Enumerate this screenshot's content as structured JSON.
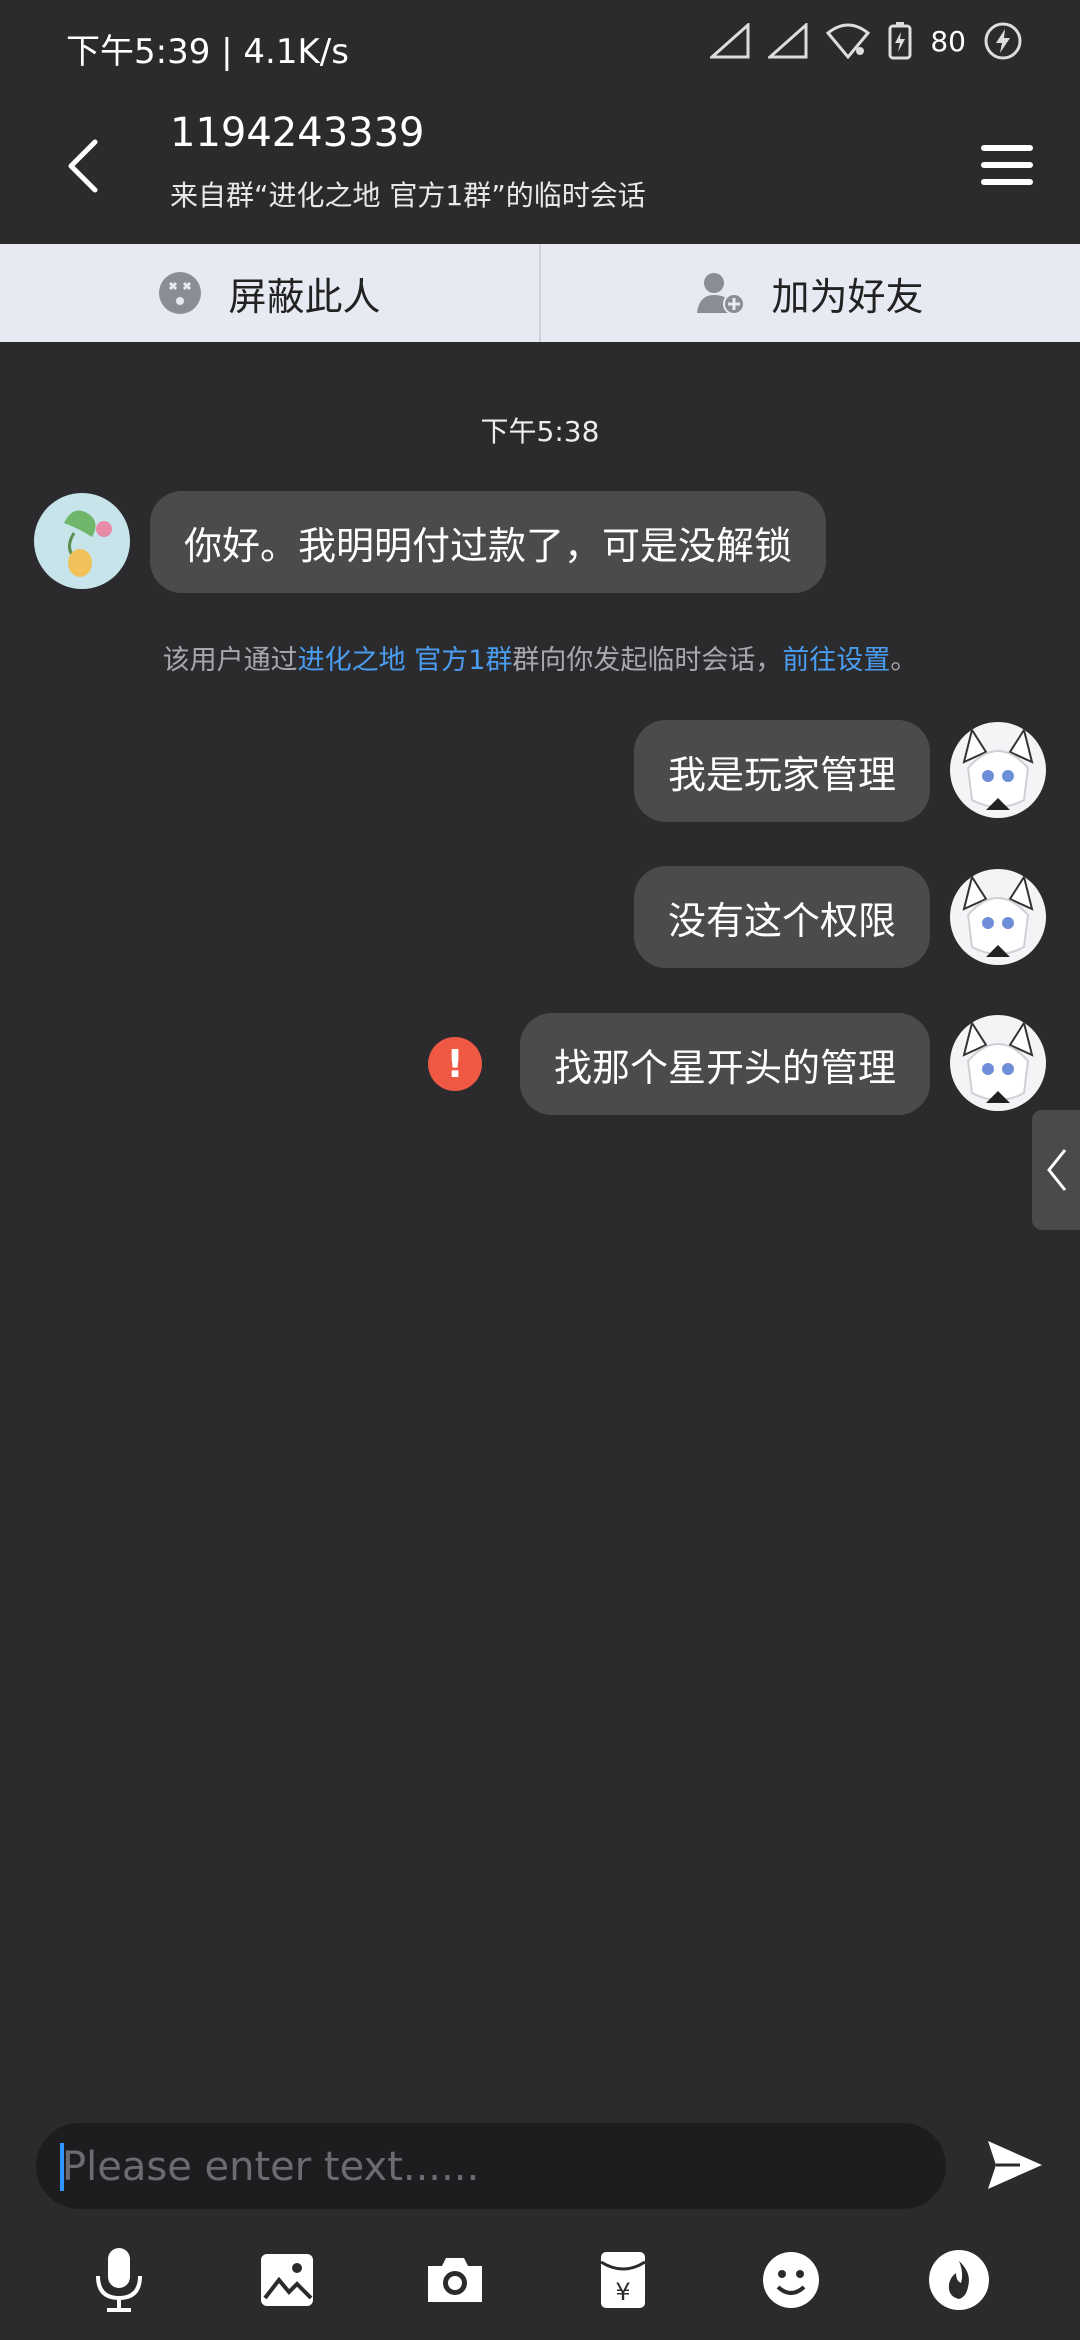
{
  "status": {
    "time_speed": "下午5:39 | 4.1K/s",
    "battery": "80"
  },
  "header": {
    "title": "1194243339",
    "subtitle": "来自群“进化之地 官方1群”的临时会话"
  },
  "actions": {
    "block_label": "屏蔽此人",
    "add_friend_label": "加为好友"
  },
  "chat": {
    "timestamp": "下午5:38",
    "messages": [
      {
        "side": "left",
        "text": "你好。我明明付过款了，可是没解锁"
      },
      {
        "side": "right",
        "text": "我是玩家管理"
      },
      {
        "side": "right",
        "text": "没有这个权限"
      },
      {
        "side": "right",
        "text": "找那个星开头的管理",
        "failed": true
      }
    ],
    "system_note": {
      "prefix": "该用户通过",
      "group_link": "进化之地 官方1群",
      "middle": "群向你发起临时会话，",
      "settings_link": "前往设置",
      "suffix": "。"
    }
  },
  "input": {
    "placeholder": "Please enter text......"
  },
  "toolbar": {
    "icons": [
      "microphone-icon",
      "image-icon",
      "camera-icon",
      "red-packet-icon",
      "emoji-icon",
      "fire-icon"
    ]
  },
  "colors": {
    "background": "#2b2b2d",
    "bubble": "#4b4b4d",
    "link": "#4a9cf0",
    "error": "#ef5843",
    "actionbar": "#e7e9f3"
  }
}
